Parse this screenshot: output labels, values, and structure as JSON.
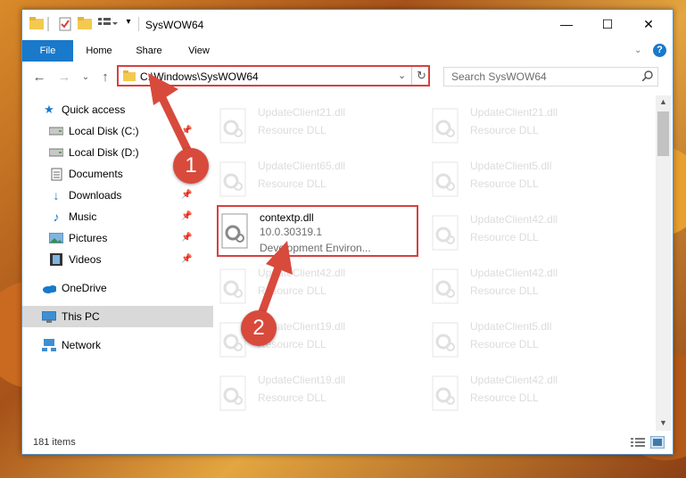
{
  "window": {
    "title": "SysWOW64",
    "controls": {
      "minimize": "—",
      "maximize": "☐",
      "close": "✕"
    }
  },
  "ribbon": {
    "tabs": [
      "File",
      "Home",
      "Share",
      "View"
    ],
    "help": "?"
  },
  "nav": {
    "address": "C:\\Windows\\SysWOW64",
    "search_placeholder": "Search SysWOW64"
  },
  "sidebar": {
    "items": [
      {
        "label": "Quick access",
        "icon": "star-icon"
      },
      {
        "label": "Local Disk (C:)",
        "icon": "drive-icon"
      },
      {
        "label": "Local Disk (D:)",
        "icon": "drive-icon"
      },
      {
        "label": "Documents",
        "icon": "documents-icon"
      },
      {
        "label": "Downloads",
        "icon": "download-icon"
      },
      {
        "label": "Music",
        "icon": "music-icon"
      },
      {
        "label": "Pictures",
        "icon": "pictures-icon"
      },
      {
        "label": "Videos",
        "icon": "videos-icon"
      },
      {
        "label": "OneDrive",
        "icon": "cloud-icon"
      },
      {
        "label": "This PC",
        "icon": "computer-icon"
      },
      {
        "label": "Network",
        "icon": "network-icon"
      }
    ]
  },
  "files": [
    {
      "name": "UpdateClient21.dll",
      "type": "Resource DLL"
    },
    {
      "name": "UpdateClient21.dll",
      "type": "Resource DLL"
    },
    {
      "name": "UpdateClient65.dll",
      "type": "Resource DLL"
    },
    {
      "name": "UpdateClient5.dll",
      "type": "Resource DLL"
    },
    {
      "name": "contextp.dll",
      "version": "10.0.30319.1",
      "type": "Development Environ..."
    },
    {
      "name": "UpdateClient42.dll",
      "type": "Resource DLL"
    },
    {
      "name": "UpdateClient42.dll",
      "type": "Resource DLL"
    },
    {
      "name": "UpdateClient42.dll",
      "type": "Resource DLL"
    },
    {
      "name": "UpdateClient19.dll",
      "type": "Resource DLL"
    },
    {
      "name": "UpdateClient5.dll",
      "type": "Resource DLL"
    },
    {
      "name": "UpdateClient19.dll",
      "type": "Resource DLL"
    },
    {
      "name": "UpdateClient42.dll",
      "type": "Resource DLL"
    }
  ],
  "status": {
    "count": "181 items"
  },
  "annotations": {
    "step1": "1",
    "step2": "2"
  },
  "colors": {
    "accent": "#1979ca",
    "annotation": "#d84a3c",
    "selected": "#d9d9d9"
  }
}
